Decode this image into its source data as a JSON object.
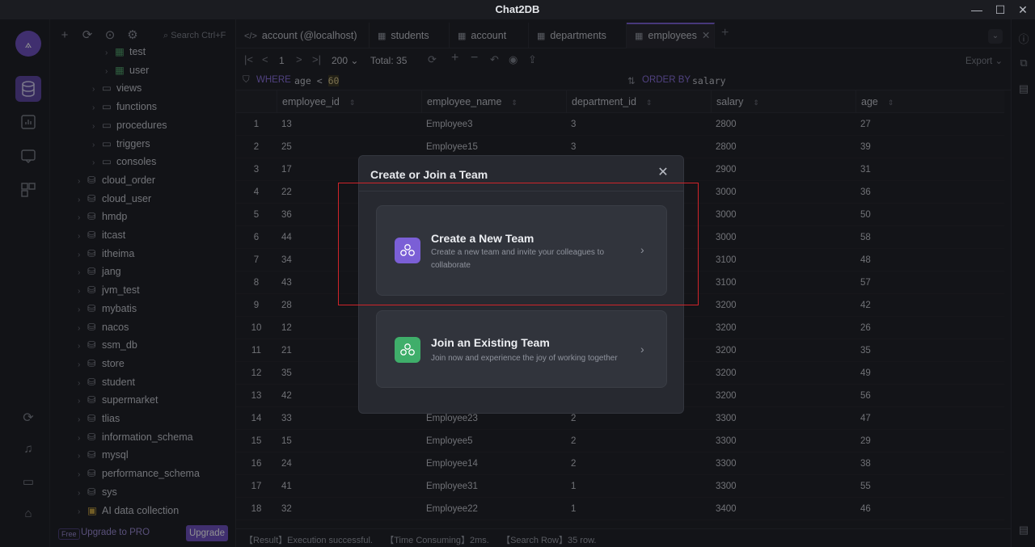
{
  "app": {
    "title": "Chat2DB"
  },
  "window_controls": {
    "minimize": "—",
    "maximize": "☐",
    "close": "✕"
  },
  "sidebar": {
    "search_placeholder": "Search  Ctrl+F",
    "tree": [
      {
        "label": "test",
        "type": "table"
      },
      {
        "label": "user",
        "type": "table"
      },
      {
        "label": "views",
        "type": "folder"
      },
      {
        "label": "functions",
        "type": "folder"
      },
      {
        "label": "procedures",
        "type": "folder"
      },
      {
        "label": "triggers",
        "type": "folder"
      },
      {
        "label": "consoles",
        "type": "folder"
      },
      {
        "label": "cloud_order",
        "type": "db"
      },
      {
        "label": "cloud_user",
        "type": "db"
      },
      {
        "label": "hmdp",
        "type": "db"
      },
      {
        "label": "itcast",
        "type": "db"
      },
      {
        "label": "itheima",
        "type": "db"
      },
      {
        "label": "jang",
        "type": "db"
      },
      {
        "label": "jvm_test",
        "type": "db"
      },
      {
        "label": "mybatis",
        "type": "db"
      },
      {
        "label": "nacos",
        "type": "db"
      },
      {
        "label": "ssm_db",
        "type": "db"
      },
      {
        "label": "store",
        "type": "db"
      },
      {
        "label": "student",
        "type": "db"
      },
      {
        "label": "supermarket",
        "type": "db"
      },
      {
        "label": "tlias",
        "type": "db"
      },
      {
        "label": "information_schema",
        "type": "db"
      },
      {
        "label": "mysql",
        "type": "db"
      },
      {
        "label": "performance_schema",
        "type": "db"
      },
      {
        "label": "sys",
        "type": "db"
      },
      {
        "label": "AI data collection",
        "type": "ai"
      }
    ],
    "free_badge": "Free",
    "upgrade_pro": "Upgrade to PRO",
    "upgrade_button": "Upgrade"
  },
  "tabs": [
    {
      "label": "account (@localhost)",
      "icon": "code-icon"
    },
    {
      "label": "students",
      "icon": "table-icon"
    },
    {
      "label": "account",
      "icon": "table-icon"
    },
    {
      "label": "departments",
      "icon": "table-icon"
    },
    {
      "label": "employees",
      "icon": "table-icon",
      "active": true
    }
  ],
  "toolbar": {
    "page": "1",
    "page_size": "200",
    "total_label": "Total:",
    "total_value": "35",
    "export": "Export"
  },
  "filter": {
    "where_label": "WHERE",
    "where_expr_left": "age <",
    "where_expr_value": "60",
    "order_label": "ORDER BY",
    "order_expr": "salary"
  },
  "grid": {
    "columns": [
      "employee_id",
      "employee_name",
      "department_id",
      "salary",
      "age"
    ],
    "rows": [
      [
        "1",
        "13",
        "Employee3",
        "3",
        "2800",
        "27"
      ],
      [
        "2",
        "25",
        "Employee15",
        "3",
        "2800",
        "39"
      ],
      [
        "3",
        "17",
        "",
        "",
        "2900",
        "31"
      ],
      [
        "4",
        "22",
        "",
        "",
        "3000",
        "36"
      ],
      [
        "5",
        "36",
        "",
        "",
        "3000",
        "50"
      ],
      [
        "6",
        "44",
        "",
        "",
        "3000",
        "58"
      ],
      [
        "7",
        "34",
        "",
        "",
        "3100",
        "48"
      ],
      [
        "8",
        "43",
        "",
        "",
        "3100",
        "57"
      ],
      [
        "9",
        "28",
        "",
        "",
        "3200",
        "42"
      ],
      [
        "10",
        "12",
        "",
        "",
        "3200",
        "26"
      ],
      [
        "11",
        "21",
        "",
        "",
        "3200",
        "35"
      ],
      [
        "12",
        "35",
        "",
        "",
        "3200",
        "49"
      ],
      [
        "13",
        "42",
        "",
        "",
        "3200",
        "56"
      ],
      [
        "14",
        "33",
        "Employee23",
        "2",
        "3300",
        "47"
      ],
      [
        "15",
        "15",
        "Employee5",
        "2",
        "3300",
        "29"
      ],
      [
        "16",
        "24",
        "Employee14",
        "2",
        "3300",
        "38"
      ],
      [
        "17",
        "41",
        "Employee31",
        "1",
        "3300",
        "55"
      ],
      [
        "18",
        "32",
        "Employee22",
        "1",
        "3400",
        "46"
      ]
    ]
  },
  "status": {
    "text": "【Result】Execution successful.     【Time Consuming】2ms.     【Search Row】35 row."
  },
  "modal": {
    "title": "Create or Join a Team",
    "create": {
      "title": "Create a New Team",
      "desc": "Create a new team and invite your colleagues to collaborate",
      "icon_color": "#7b5fd6"
    },
    "join": {
      "title": "Join an Existing Team",
      "desc": "Join now and experience the joy of working together",
      "icon_color": "#3fae6a"
    }
  },
  "colors": {
    "accent": "#6d4fc2",
    "highlight_box": "#d0242a"
  }
}
